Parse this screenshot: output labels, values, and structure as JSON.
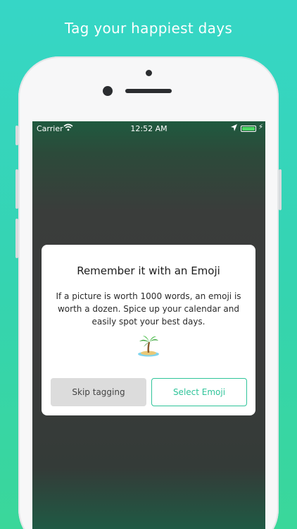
{
  "headline": "Tag your happiest days",
  "statusbar": {
    "carrier": "Carrier",
    "time": "12:52 AM",
    "battery_level": 1.0
  },
  "dialog": {
    "title": "Remember it with an Emoji",
    "body": "If a picture is worth 1000 words, an emoji is worth a dozen. Spice up your calendar and easily spot your best days.",
    "emoji_icon": "desert-island-icon",
    "skip_label": "Skip tagging",
    "select_label": "Select Emoji"
  },
  "colors": {
    "background_top": "#36d6c6",
    "background_bottom": "#3ad79a",
    "accent": "#2fc49a",
    "skip_button": "#dcdcdc"
  }
}
